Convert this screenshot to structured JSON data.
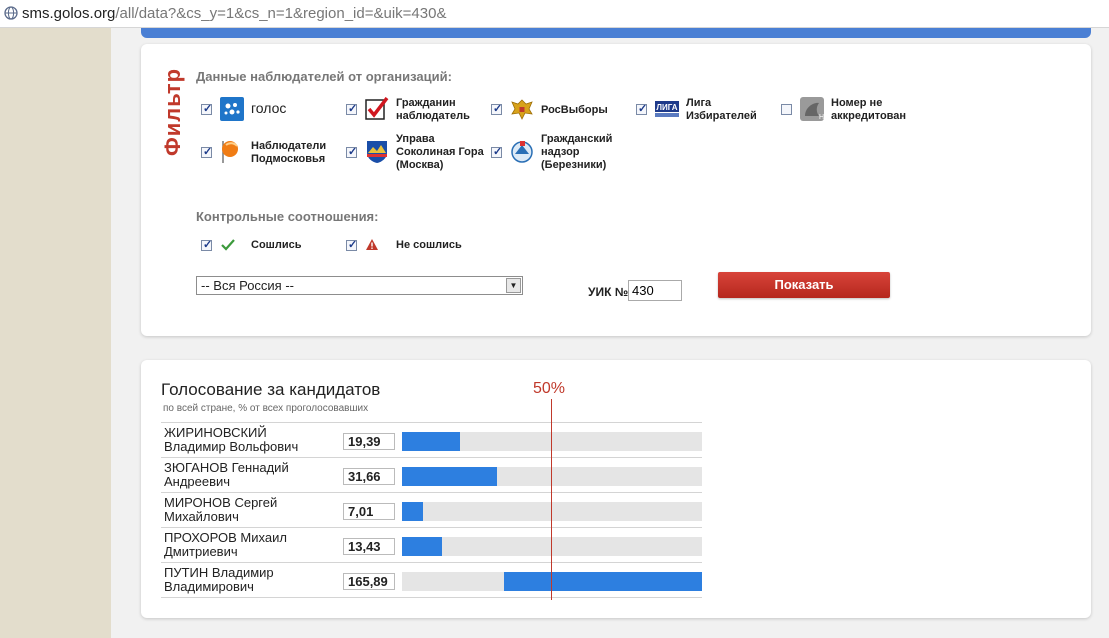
{
  "browser": {
    "url_host": "sms.golos.org",
    "url_path": "/all/data?&cs_y=1&cs_n=1&region_id=&uik=430&"
  },
  "filter": {
    "title": "Фильтр",
    "orgs_label": "Данные наблюдателей от организаций:",
    "orgs": [
      {
        "label_lines": [
          "голос"
        ],
        "icon": "golos-logo-icon",
        "checked": true
      },
      {
        "label_lines": [
          "Гражданин",
          "наблюдатель"
        ],
        "icon": "red-checkmark-logo-icon",
        "checked": true
      },
      {
        "label_lines": [
          "РосВыборы"
        ],
        "icon": "russian-eagle-emblem-icon",
        "checked": true
      },
      {
        "label_lines": [
          "Лига",
          "Избирателей"
        ],
        "icon": "liga-logo-icon",
        "checked": true
      },
      {
        "label_lines": [
          "Номер не",
          "аккредитован"
        ],
        "icon": "not-accredited-icon",
        "checked": false
      },
      {
        "label_lines": [
          "Наблюдатели",
          "Подмосковья"
        ],
        "icon": "orange-flag-icon",
        "checked": true
      },
      {
        "label_lines": [
          "Управа",
          "Соколиная Гора",
          "(Москва)"
        ],
        "icon": "sokolinaya-gora-emblem-icon",
        "checked": true
      },
      {
        "label_lines": [
          "Гражданский",
          "надзор",
          "(Березники)"
        ],
        "icon": "berezniki-emblem-icon",
        "checked": true
      }
    ],
    "control_label": "Контрольные соотношения:",
    "control": [
      {
        "label": "Сошлись",
        "icon": "green-check-icon",
        "checked": true
      },
      {
        "label": "Не сошлись",
        "icon": "warning-icon",
        "checked": true
      }
    ],
    "region_select": "-- Вся Россия --",
    "uik_label": "УИК №",
    "uik_value": "430",
    "show_button": "Показать"
  },
  "voting": {
    "title": "Голосование за кандидатов",
    "subtitle": "по всей стране, % от всех проголосовавших",
    "half_label": "50%",
    "candidates": [
      {
        "name_lines": [
          "ЖИРИНОВСКИЙ",
          "Владимир Вольфович"
        ],
        "value": "19,39",
        "percent": 19.39
      },
      {
        "name_lines": [
          "ЗЮГАНОВ Геннадий",
          "Андреевич"
        ],
        "value": "31,66",
        "percent": 31.66
      },
      {
        "name_lines": [
          "МИРОНОВ Сергей",
          "Михайлович"
        ],
        "value": "7,01",
        "percent": 7.01
      },
      {
        "name_lines": [
          "ПРОХОРОВ Михаил",
          "Дмитриевич"
        ],
        "value": "13,43",
        "percent": 13.43
      },
      {
        "name_lines": [
          "ПУТИН Владимир",
          "Владимирович"
        ],
        "value": "165,89",
        "percent": 165.89
      }
    ]
  },
  "colors": {
    "accent_red": "#c0392b",
    "bar_blue": "#2d7fe0",
    "header_blue": "#4a7fd4"
  }
}
